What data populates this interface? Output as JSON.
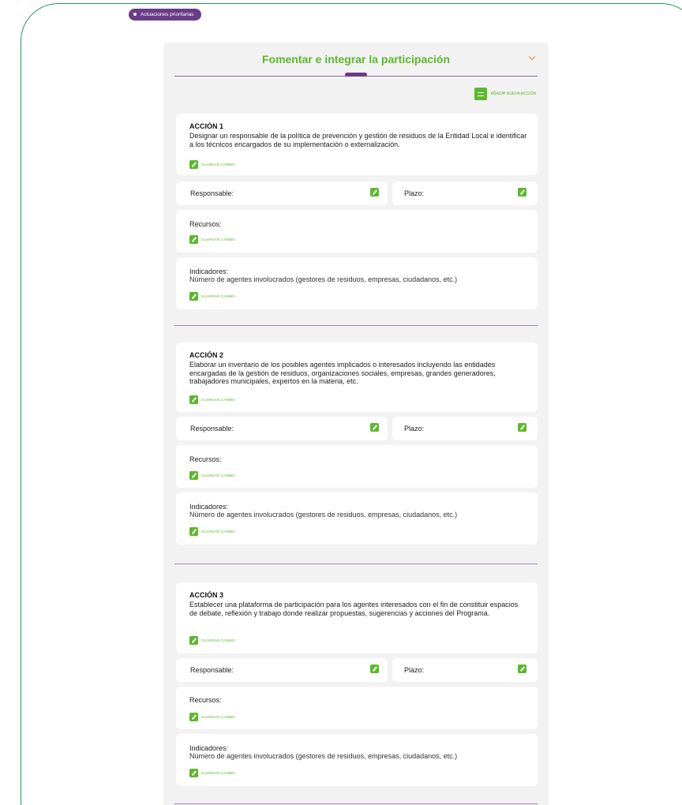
{
  "tag": {
    "label": "Actuaciones prioritarias"
  },
  "panel": {
    "title": "Fomentar e integrar la participación",
    "add_action_label": "AÑADIR NUEVA ACCIÓN"
  },
  "labels": {
    "save": "GUARDAR CAMBIO",
    "responsable": "Responsable:",
    "plazo": "Plazo:",
    "recursos": "Recursos:",
    "indicadores": "Indicadores:"
  },
  "actions": [
    {
      "title": "ACCIÓN 1",
      "description": "Designar un responsable de la política de prevención y gestión de residuos de la Entidad Local e identificar a los técnicos encargados de su implementación o externalización.",
      "indicator": "Número de agentes involucrados (gestores de residuos, empresas, ciudadanos, etc.)"
    },
    {
      "title": "ACCIÓN 2",
      "description": "Elaborar un inventario de los posibles agentes implicados o interesados incluyendo las entidades encargadas de la gestión de residuos, organizaciones sociales, empresas, grandes generadores, trabajadores municipales, expertos en la materia, etc.",
      "indicator": "Número de agentes involucrados (gestores de residuos, empresas, ciudadanos, etc.)"
    },
    {
      "title": "ACCIÓN 3",
      "description": "Establecer una plataforma de participación para los agentes interesados con el fin de constituir espacios de debate, reflexión y trabajo donde realizar propuestas, sugerencias y acciones del Programa.",
      "indicator": "Número de agentes involucrados (gestores de residuos, empresas, ciudadanos, etc.)"
    }
  ]
}
